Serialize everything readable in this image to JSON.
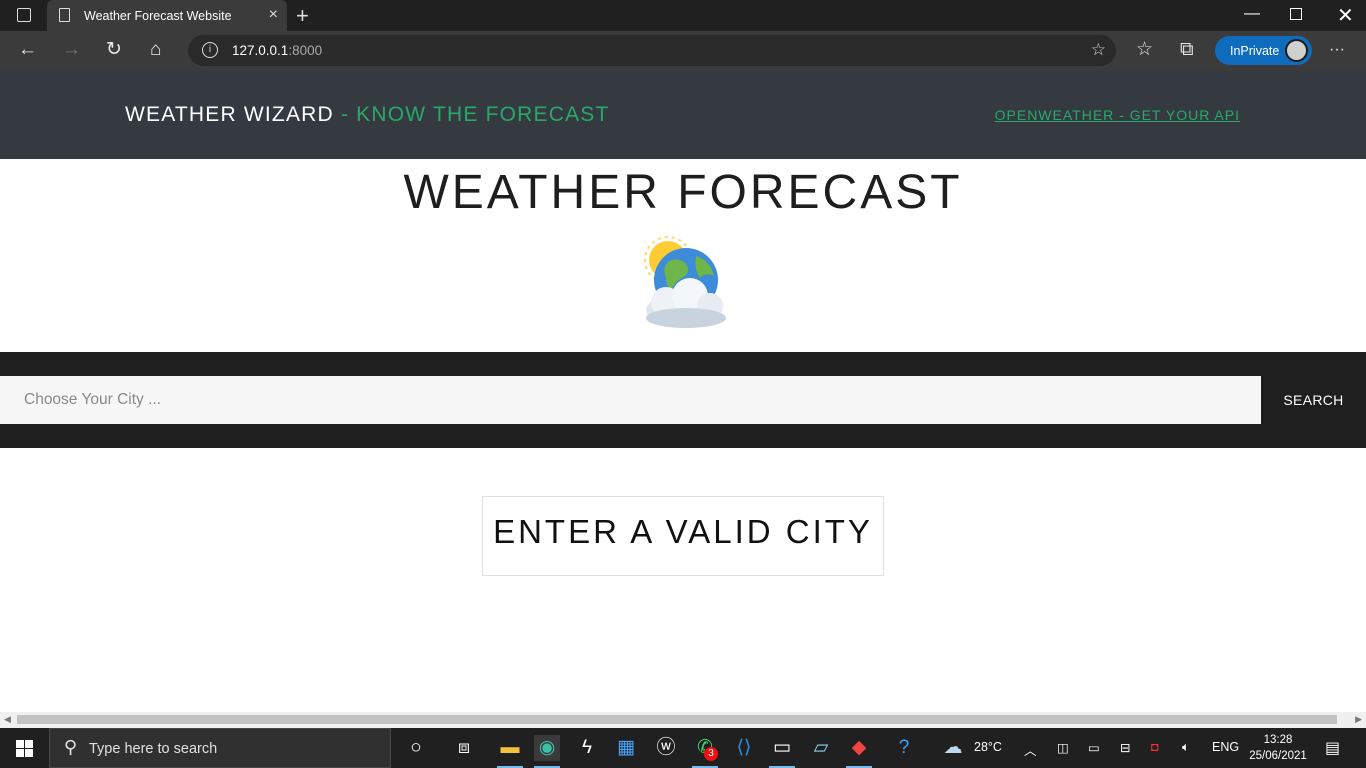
{
  "browser": {
    "tab_title": "Weather Forecast Website",
    "url_host": "127.0.0.1",
    "url_port": ":8000",
    "inprivate_label": "InPrivate"
  },
  "site": {
    "brand_name": "WEATHER WIZARD",
    "brand_tagline": " - KNOW THE FORECAST",
    "api_link": "OPENWEATHER - GET YOUR API",
    "hero_title": "WEATHER FORECAST",
    "hero_icon": "sun-behind-cloud-globe-icon",
    "search_placeholder": "Choose Your City ...",
    "search_value": "",
    "search_button": "SEARCH",
    "message": "ENTER A VALID CITY"
  },
  "colors": {
    "header_bg": "#343a40",
    "accent_green": "#28a96a",
    "search_band_bg": "#1f1f1f"
  },
  "taskbar": {
    "search_placeholder": "Type here to search",
    "whatsapp_badge": "3",
    "weather_temp": "28°C",
    "language": "ENG",
    "time": "13:28",
    "date": "25/06/2021"
  }
}
